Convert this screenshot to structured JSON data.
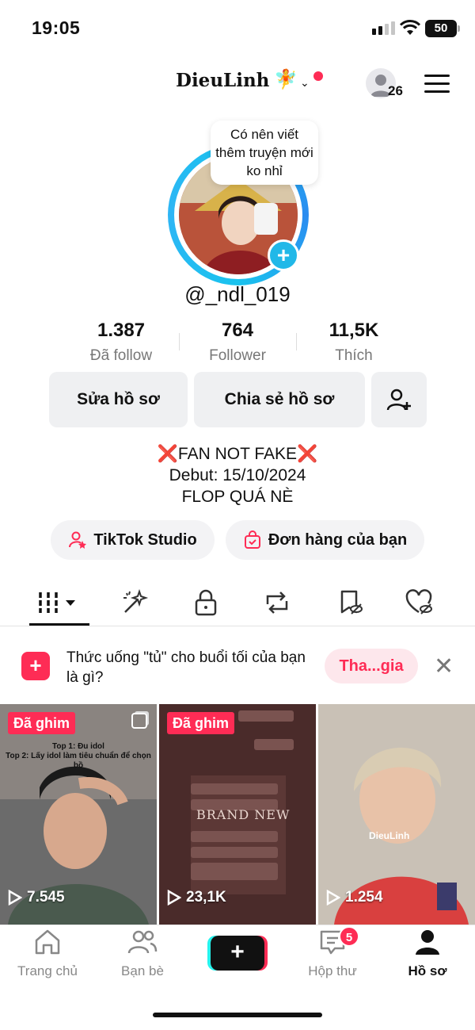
{
  "status_bar": {
    "time": "19:05",
    "battery": "50"
  },
  "header": {
    "username": "DieuLinh",
    "username_emoji": "🧚",
    "friends_count": "26"
  },
  "profile": {
    "note_bubble": "Có nên viết thêm truyện mới ko nhỉ",
    "handle": "@_ndl_019",
    "stats": [
      {
        "value": "1.387",
        "label": "Đã follow"
      },
      {
        "value": "764",
        "label": "Follower"
      },
      {
        "value": "11,5K",
        "label": "Thích"
      }
    ],
    "buttons": {
      "edit": "Sửa hồ sơ",
      "share": "Chia sẻ hồ sơ"
    },
    "bio": [
      "❌FAN NOT FAKE❌",
      "Debut: 15/10/2024",
      "FLOP QUÁ NÈ"
    ],
    "pills": {
      "studio": "TikTok Studio",
      "orders": "Đơn hàng của bạn"
    }
  },
  "banner": {
    "text": "Thức uống \"tủ\" cho buổi tối của bạn là gì?",
    "join": "Tha...gia"
  },
  "videos": [
    {
      "pinned": "Đã ghim",
      "views": "7.545",
      "caption_1": "Top 1: Đu idol",
      "caption_2": "Top 2: Lấy idol làm tiêu chuẩn để chọn bồ"
    },
    {
      "pinned": "Đã ghim",
      "views": "23,1K",
      "overlay": "BRAND NEW"
    },
    {
      "views": "1.254",
      "caption": "DieuLinh"
    }
  ],
  "nav": {
    "home": "Trang chủ",
    "friends": "Bạn bè",
    "inbox": "Hộp thư",
    "inbox_badge": "5",
    "profile": "Hồ sơ"
  },
  "colors": {
    "accent": "#fe2c55",
    "ring": "#19c3ee"
  }
}
